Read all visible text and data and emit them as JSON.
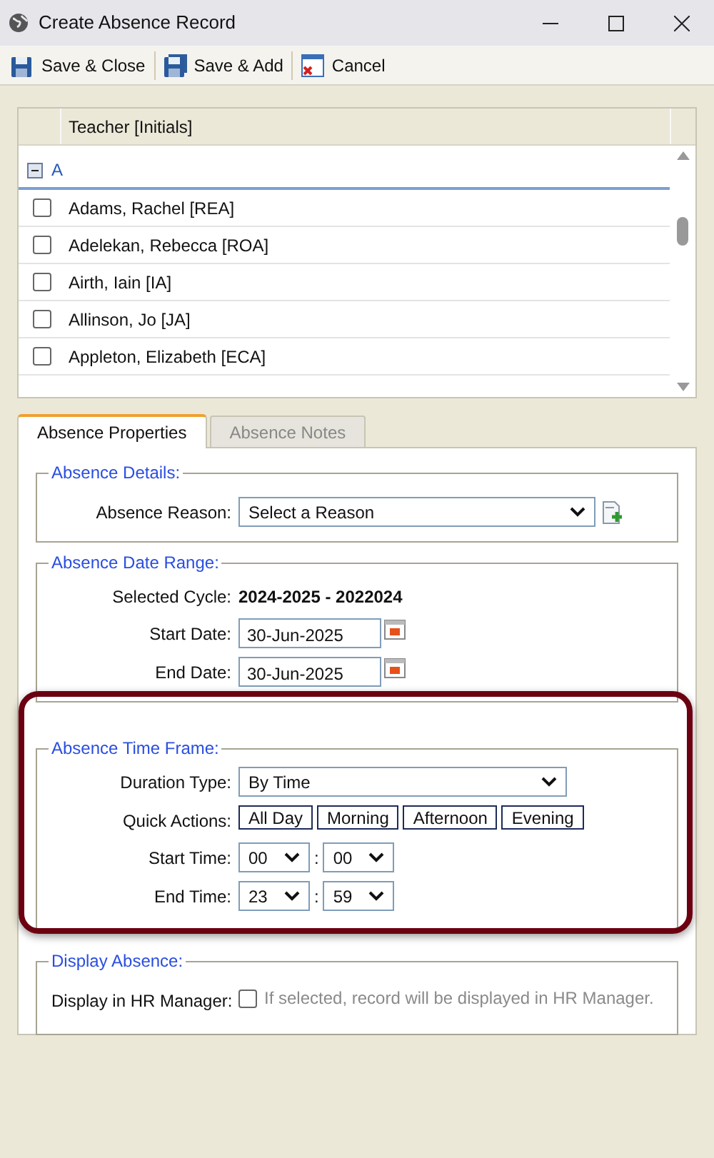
{
  "window": {
    "title": "Create Absence Record"
  },
  "toolbar": [
    {
      "label": "Save & Close",
      "kind": "save"
    },
    {
      "label": "Save & Add",
      "kind": "saveadd"
    },
    {
      "label": "Cancel",
      "kind": "cancel"
    }
  ],
  "list": {
    "column": "Teacher [Initials]",
    "groups": [
      {
        "label": "A",
        "expanded": true,
        "children": [
          {
            "name": "Adams, Rachel [REA]",
            "checked": false
          },
          {
            "name": "Adelekan, Rebecca [ROA]",
            "checked": false
          },
          {
            "name": "Airth, Iain [IA]",
            "checked": false
          },
          {
            "name": "Allinson, Jo [JA]",
            "checked": false
          },
          {
            "name": "Appleton, Elizabeth [ECA]",
            "checked": false
          }
        ]
      }
    ]
  },
  "tabs": [
    {
      "label": "Absence Properties",
      "selected": true
    },
    {
      "label": "Absence Notes",
      "selected": false
    }
  ],
  "sections": [
    {
      "legend": "Absence Details:",
      "fields": [
        {
          "kind": "select",
          "label": "Absence Reason:",
          "value": "Select a Reason",
          "add": true
        }
      ]
    },
    {
      "legend": "Absence Date Range:",
      "fields": [
        {
          "kind": "text",
          "label": "Selected Cycle:",
          "value": "2024-2025 - 2022024"
        },
        {
          "kind": "date",
          "label": "Start Date:",
          "value": "30-Jun-2025"
        },
        {
          "kind": "date",
          "label": "End Date:",
          "value": "30-Jun-2025"
        }
      ]
    },
    {
      "legend": "Absence Time Frame:",
      "highlighted": true,
      "fields": [
        {
          "kind": "select",
          "label": "Duration Type:",
          "value": "By Time",
          "add": false
        },
        {
          "kind": "buttons",
          "label": "Quick Actions:",
          "buttons": [
            "All Day",
            "Morning",
            "Afternoon",
            "Evening"
          ]
        },
        {
          "kind": "time",
          "label": "Start Time:",
          "hour": "00",
          "minute": "00",
          "separator": ":"
        },
        {
          "kind": "time",
          "label": "End Time:",
          "hour": "23",
          "minute": "59",
          "separator": ":"
        }
      ]
    },
    {
      "legend": "Display Absence:",
      "fields": [
        {
          "kind": "checkbox",
          "label": "Display in HR Manager:",
          "checked": false,
          "hint": "If selected, record will be displayed in HR Manager."
        }
      ]
    }
  ]
}
